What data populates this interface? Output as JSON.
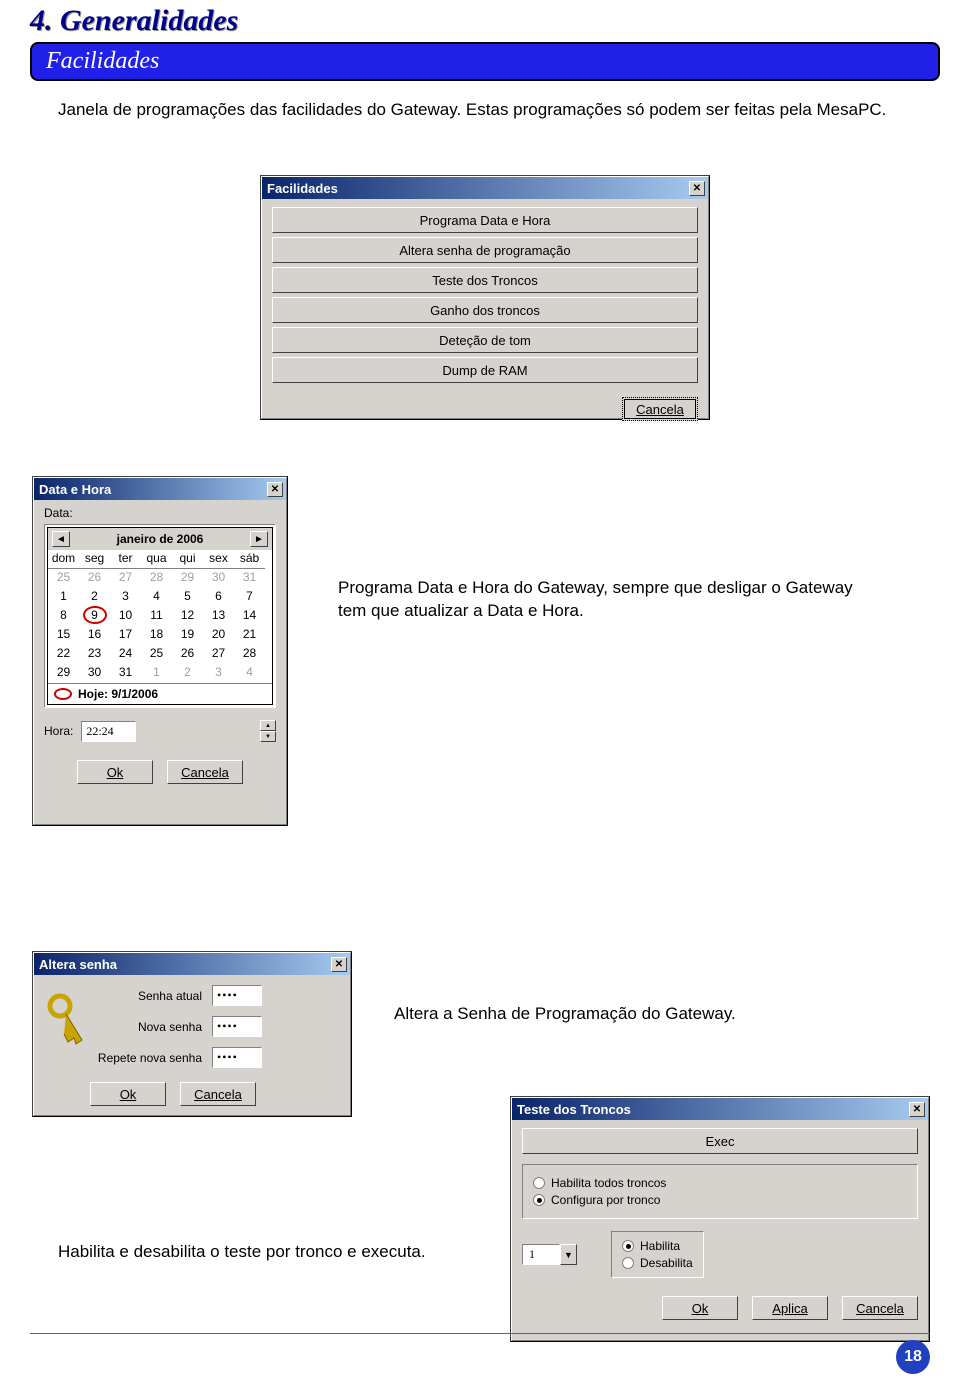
{
  "header": {
    "section_title": "4. Generalidades",
    "subsection": "Facilidades"
  },
  "intro_text": "Janela de programações das facilidades do Gateway. Estas programações só podem ser feitas pela MesaPC.",
  "facilidades_dialog": {
    "title": "Facilidades",
    "items": [
      "Programa Data e Hora",
      "Altera senha de programação",
      "Teste dos Troncos",
      "Ganho dos troncos",
      "Deteção de tom",
      "Dump de RAM"
    ],
    "cancel": "Cancela"
  },
  "datahora": {
    "title": "Data e Hora",
    "label_data": "Data:",
    "month": "janeiro de 2006",
    "dow": [
      "dom",
      "seg",
      "ter",
      "qua",
      "qui",
      "sex",
      "sáb"
    ],
    "weeks": [
      [
        {
          "d": "25",
          "dim": true
        },
        {
          "d": "26",
          "dim": true
        },
        {
          "d": "27",
          "dim": true
        },
        {
          "d": "28",
          "dim": true
        },
        {
          "d": "29",
          "dim": true
        },
        {
          "d": "30",
          "dim": true
        },
        {
          "d": "31",
          "dim": true
        }
      ],
      [
        {
          "d": "1"
        },
        {
          "d": "2"
        },
        {
          "d": "3"
        },
        {
          "d": "4"
        },
        {
          "d": "5"
        },
        {
          "d": "6"
        },
        {
          "d": "7"
        }
      ],
      [
        {
          "d": "8"
        },
        {
          "d": "9",
          "today": true
        },
        {
          "d": "10"
        },
        {
          "d": "11"
        },
        {
          "d": "12"
        },
        {
          "d": "13"
        },
        {
          "d": "14"
        }
      ],
      [
        {
          "d": "15"
        },
        {
          "d": "16"
        },
        {
          "d": "17"
        },
        {
          "d": "18"
        },
        {
          "d": "19"
        },
        {
          "d": "20"
        },
        {
          "d": "21"
        }
      ],
      [
        {
          "d": "22"
        },
        {
          "d": "23"
        },
        {
          "d": "24"
        },
        {
          "d": "25"
        },
        {
          "d": "26"
        },
        {
          "d": "27"
        },
        {
          "d": "28"
        }
      ],
      [
        {
          "d": "29"
        },
        {
          "d": "30"
        },
        {
          "d": "31"
        },
        {
          "d": "1",
          "dim": true
        },
        {
          "d": "2",
          "dim": true
        },
        {
          "d": "3",
          "dim": true
        },
        {
          "d": "4",
          "dim": true
        }
      ]
    ],
    "hoje": "Hoje: 9/1/2006",
    "label_hora": "Hora:",
    "hora_value": "22:24",
    "ok": "Ok",
    "cancel": "Cancela"
  },
  "side_note1": "Programa Data e Hora do Gateway, sempre que desligar o Gateway tem que atualizar a Data e Hora.",
  "altera_senha": {
    "title": "Altera senha",
    "label_atual": "Senha atual",
    "label_nova": "Nova senha",
    "label_repete": "Repete nova senha",
    "mask": "••••",
    "ok": "Ok",
    "cancel": "Cancela"
  },
  "side_note2": "Altera a Senha de Programação do Gateway.",
  "teste_troncos": {
    "title": "Teste dos Troncos",
    "exec": "Exec",
    "opt_all": "Habilita todos troncos",
    "opt_cfg": "Configura por tronco",
    "tronco_value": "1",
    "habilita": "Habilita",
    "desabilita": "Desabilita",
    "ok": "Ok",
    "aplica": "Aplica",
    "cancel": "Cancela"
  },
  "bottom_note": "Habilita e desabilita o teste por tronco e executa.",
  "page_number": "18"
}
